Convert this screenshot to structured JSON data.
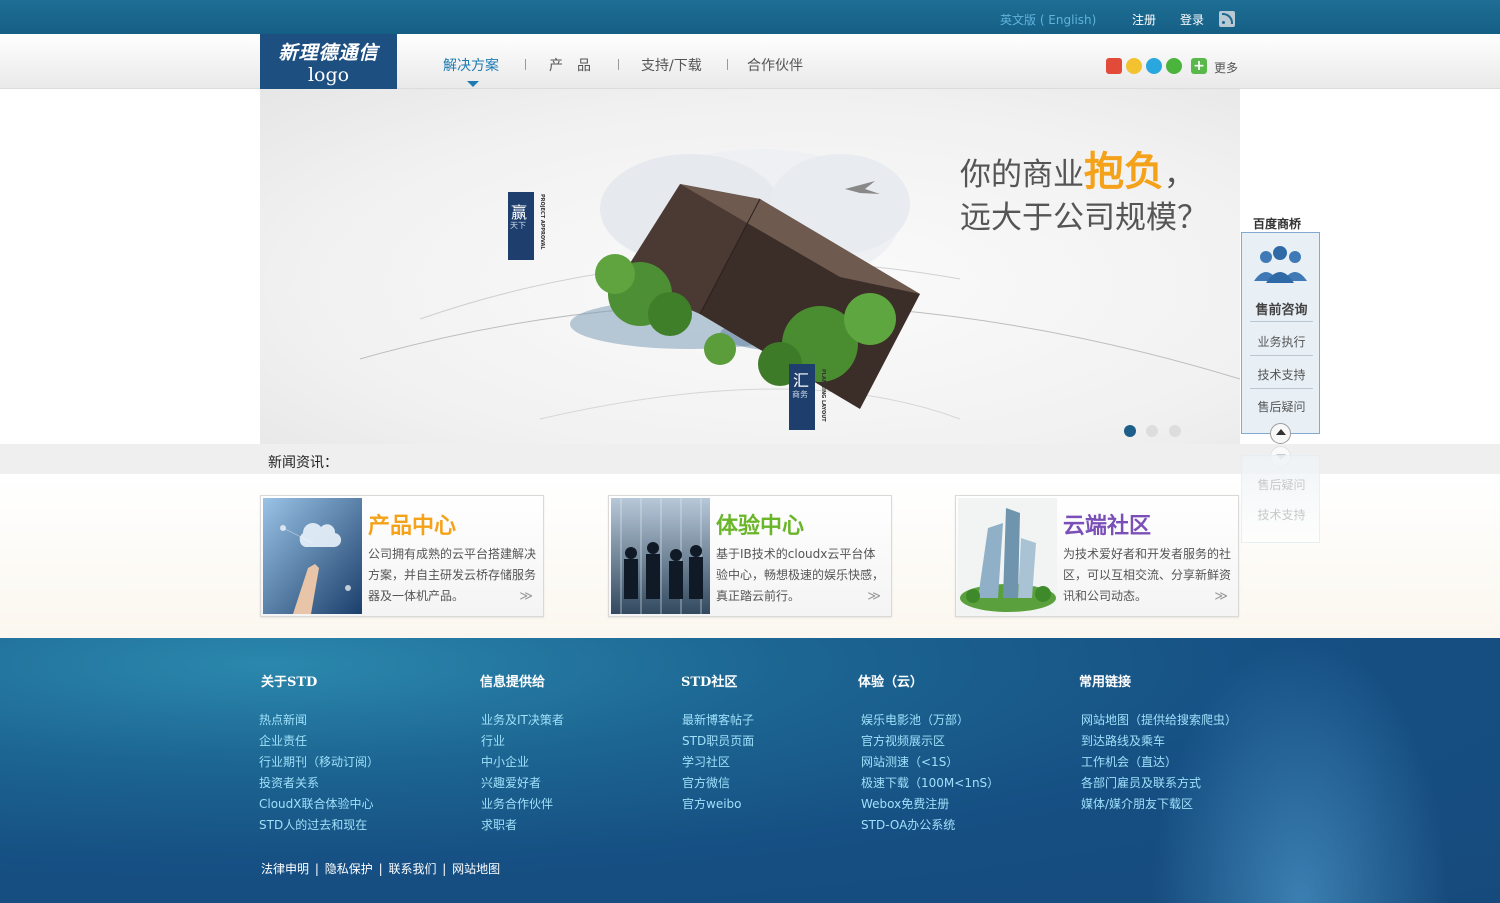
{
  "topbar": {
    "english_label": "英文版 ( English)",
    "register_label": "注册",
    "login_label": "登录",
    "rss_icon": "rss-icon"
  },
  "logo": {
    "line1": "新理德通信",
    "line2": "logo"
  },
  "nav": {
    "items": [
      {
        "label": "解决方案",
        "active": true
      },
      {
        "label": "产　品",
        "active": false
      },
      {
        "label": "支持/下载",
        "active": false
      },
      {
        "label": "合作伙伴",
        "active": false
      }
    ],
    "share_icons": [
      "weibo-icon",
      "qzone-icon",
      "qq-icon",
      "wechat-icon",
      "plus-icon"
    ],
    "more_label": "更多"
  },
  "banner": {
    "slogan_prefix": "你的商业",
    "slogan_highlight": "抱负",
    "slogan_suffix": "，",
    "slogan_line2": "远大于公司规模？",
    "badge_top_char": "赢",
    "badge_top_sub": "天下",
    "badge_top_vertical": "PROJECT APPROVAL",
    "badge_bottom_char": "汇",
    "badge_bottom_sub": "商务",
    "badge_bottom_vertical": "PLANNING LAYOUT",
    "slide_count": 3,
    "active_slide": 1
  },
  "news": {
    "label": "新闻资讯："
  },
  "cards": [
    {
      "title": "产品中心",
      "title_color": "#f5a21b",
      "desc": "公司拥有成熟的云平台搭建解决方案，并自主研发云桥存储服务器及一体机产品。",
      "more": "≫"
    },
    {
      "title": "体验中心",
      "title_color": "#6ab528",
      "desc": "基于IB技术的cloudx云平台体验中心，畅想极速的娱乐快感，真正踏云前行。",
      "more": "≫"
    },
    {
      "title": "云端社区",
      "title_color": "#7b4fb8",
      "desc": "为技术爱好者和开发者服务的社区，可以互相交流、分享新鲜资讯和公司动态。",
      "more": "≫"
    }
  ],
  "side_widget": {
    "title": "百度商桥",
    "items": [
      "售前咨询",
      "业务执行",
      "技术支持",
      "售后疑问"
    ],
    "ghost_items": [
      "售后疑问",
      "技术支持"
    ]
  },
  "footer": {
    "columns": [
      {
        "heading": "关于STD",
        "links": [
          "热点新闻",
          "企业责任",
          "行业期刊（移动订阅）",
          "投资者关系",
          "CloudX联合体验中心",
          "STD人的过去和现在"
        ]
      },
      {
        "heading": "信息提供给",
        "links": [
          "业务及IT决策者",
          "行业",
          "中小企业",
          "兴趣爱好者",
          "业务合作伙伴",
          "求职者"
        ]
      },
      {
        "heading": "STD社区",
        "links": [
          "最新博客帖子",
          "STD职员页面",
          "学习社区",
          "官方微信",
          "官方weibo"
        ]
      },
      {
        "heading": "体验（云）",
        "links": [
          "娱乐电影池（万部）",
          "官方视频展示区",
          "网站测速（<1S）",
          "极速下载（100M<1nS）",
          "Webox免费注册",
          "STD-OA办公系统"
        ]
      },
      {
        "heading": "常用链接",
        "links": [
          "网站地图（提供给搜索爬虫）",
          "到达路线及乘车",
          "工作机会（直达）",
          "各部门雇员及联系方式",
          "媒体/媒介朋友下载区"
        ]
      }
    ],
    "legal": [
      "法律申明",
      "隐私保护",
      "联系我们",
      "网站地图"
    ],
    "legal_sep": "|"
  }
}
